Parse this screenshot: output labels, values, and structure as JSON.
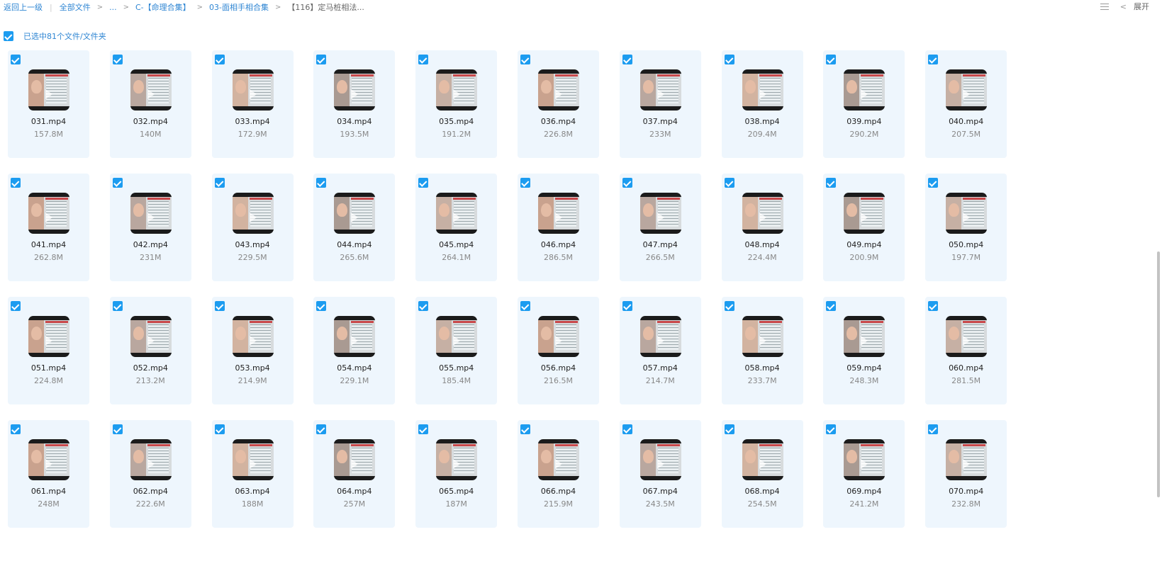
{
  "breadcrumb": {
    "back_label": "返回上一级",
    "items": [
      "全部文件",
      "...",
      "C-【命理合集】",
      "03-面相手相合集",
      "【116】定马桩相法..."
    ]
  },
  "toolbar": {
    "list_icon": "list-view-icon",
    "back_icon": "chevron-left-icon",
    "expand_label": "展开"
  },
  "selection": {
    "label": "已选中81个文件/文件夹",
    "checked": true
  },
  "files": [
    {
      "name": "031.mp4",
      "size": "157.8M"
    },
    {
      "name": "032.mp4",
      "size": "140M"
    },
    {
      "name": "033.mp4",
      "size": "172.9M"
    },
    {
      "name": "034.mp4",
      "size": "193.5M"
    },
    {
      "name": "035.mp4",
      "size": "191.2M"
    },
    {
      "name": "036.mp4",
      "size": "226.8M"
    },
    {
      "name": "037.mp4",
      "size": "233M"
    },
    {
      "name": "038.mp4",
      "size": "209.4M"
    },
    {
      "name": "039.mp4",
      "size": "290.2M"
    },
    {
      "name": "040.mp4",
      "size": "207.5M"
    },
    {
      "name": "041.mp4",
      "size": "262.8M"
    },
    {
      "name": "042.mp4",
      "size": "231M"
    },
    {
      "name": "043.mp4",
      "size": "229.5M"
    },
    {
      "name": "044.mp4",
      "size": "265.6M"
    },
    {
      "name": "045.mp4",
      "size": "264.1M"
    },
    {
      "name": "046.mp4",
      "size": "286.5M"
    },
    {
      "name": "047.mp4",
      "size": "266.5M"
    },
    {
      "name": "048.mp4",
      "size": "224.4M"
    },
    {
      "name": "049.mp4",
      "size": "200.9M"
    },
    {
      "name": "050.mp4",
      "size": "197.7M"
    },
    {
      "name": "051.mp4",
      "size": "224.8M"
    },
    {
      "name": "052.mp4",
      "size": "213.2M"
    },
    {
      "name": "053.mp4",
      "size": "214.9M"
    },
    {
      "name": "054.mp4",
      "size": "229.1M"
    },
    {
      "name": "055.mp4",
      "size": "185.4M"
    },
    {
      "name": "056.mp4",
      "size": "216.5M"
    },
    {
      "name": "057.mp4",
      "size": "214.7M"
    },
    {
      "name": "058.mp4",
      "size": "233.7M"
    },
    {
      "name": "059.mp4",
      "size": "248.3M"
    },
    {
      "name": "060.mp4",
      "size": "281.5M"
    },
    {
      "name": "061.mp4",
      "size": "248M"
    },
    {
      "name": "062.mp4",
      "size": "222.6M"
    },
    {
      "name": "063.mp4",
      "size": "188M"
    },
    {
      "name": "064.mp4",
      "size": "257M"
    },
    {
      "name": "065.mp4",
      "size": "187M"
    },
    {
      "name": "066.mp4",
      "size": "215.9M"
    },
    {
      "name": "067.mp4",
      "size": "243.5M"
    },
    {
      "name": "068.mp4",
      "size": "254.5M"
    },
    {
      "name": "069.mp4",
      "size": "241.2M"
    },
    {
      "name": "070.mp4",
      "size": "232.8M"
    }
  ],
  "colors": {
    "accent": "#1c9cf0",
    "link": "#2f86d3",
    "tile_bg": "#eef6fd"
  }
}
